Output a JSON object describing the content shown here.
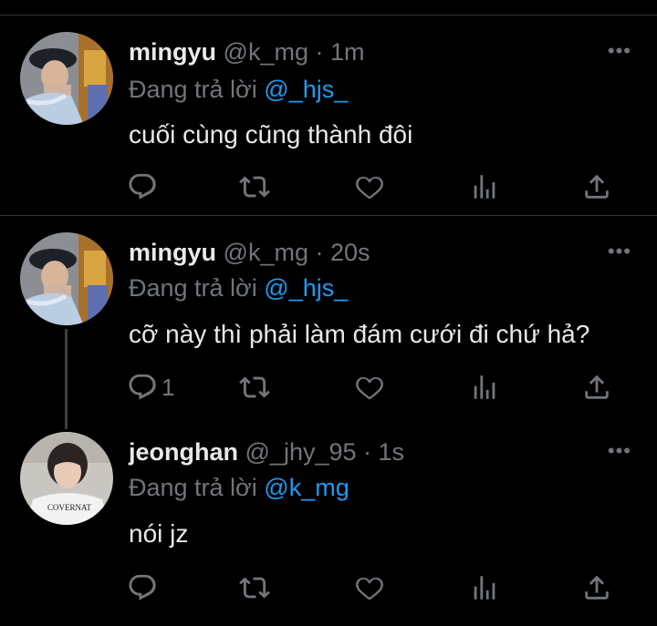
{
  "tweets": [
    {
      "name": "mingyu",
      "handle": "@k_mg",
      "time": "· 1m",
      "reply_prefix": "Đang trả lời",
      "reply_handle": "@_hjs_",
      "text": "cuối cùng cũng thành đôi",
      "reply_count": "",
      "more": "•••"
    },
    {
      "name": "mingyu",
      "handle": "@k_mg",
      "time": "· 20s",
      "reply_prefix": "Đang trả lời",
      "reply_handle": "@_hjs_",
      "text": "cỡ này thì phải làm đám cưới đi chứ hả?",
      "reply_count": "1",
      "more": "•••"
    },
    {
      "name": "jeonghan",
      "handle": "@_jhy_95",
      "time": "· 1s",
      "reply_prefix": "Đang trả lời",
      "reply_handle": "@k_mg",
      "text": "nói jz",
      "reply_count": "",
      "more": "•••"
    }
  ],
  "colors": {
    "background": "#000000",
    "text": "#e7e9ea",
    "muted": "#71767b",
    "link": "#1d9bf0",
    "divider": "#2f3336"
  },
  "icons": [
    "reply-icon",
    "retweet-icon",
    "like-icon",
    "views-icon",
    "share-icon",
    "more-icon"
  ]
}
